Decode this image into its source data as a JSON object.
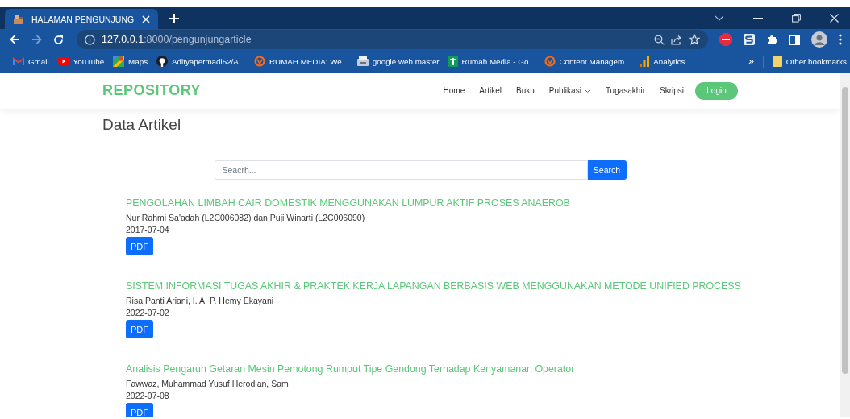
{
  "browser": {
    "tabs": [
      {
        "title": "HALAMAN PENGUNJUNG",
        "selected": true
      }
    ],
    "nav_buttons": [
      {
        "kind": "back",
        "disabled": false
      },
      {
        "kind": "forward",
        "disabled": true
      },
      {
        "kind": "reload",
        "disabled": false
      }
    ],
    "url_host": "127.0.0.1",
    "url_path": ":8000/pengunjungarticle",
    "bookmarks": [
      {
        "kind": "gmail",
        "label": "Gmail"
      },
      {
        "kind": "youtube",
        "label": "YouTube"
      },
      {
        "kind": "maps",
        "label": "Maps"
      },
      {
        "kind": "github",
        "label": "Adityapermadi52/A..."
      },
      {
        "kind": "ring",
        "label": "RUMAH MEDIA: We..."
      },
      {
        "kind": "tray",
        "label": "google web master"
      },
      {
        "kind": "sheet",
        "label": "Rumah Media - Go..."
      },
      {
        "kind": "ring",
        "label": "Content Managem..."
      },
      {
        "kind": "bars",
        "label": "Analytics"
      }
    ],
    "overflow": "»",
    "other_bookmarks": "Other bookmarks"
  },
  "site": {
    "brand": "REPOSITORY",
    "nav": [
      {
        "label": "Home",
        "dropdown": false
      },
      {
        "label": "Artikel",
        "dropdown": false
      },
      {
        "label": "Buku",
        "dropdown": false
      },
      {
        "label": "Publikasi",
        "dropdown": true
      },
      {
        "label": "Tugasakhir",
        "dropdown": false
      },
      {
        "label": "Skripsi",
        "dropdown": false
      }
    ],
    "login": "Login"
  },
  "page_title": "Data Artikel",
  "search": {
    "placeholder": "Seacrh...",
    "button": "Search"
  },
  "articles": [
    {
      "title": "PENGOLAHAN LIMBAH CAIR DOMESTIK MENGGUNAKAN LUMPUR AKTIF PROSES ANAEROB",
      "authors": "Nur Rahmi Sa'adah (L2C006082) dan Puji Winarti (L2C006090)",
      "date": "2017-07-04",
      "button": "PDF"
    },
    {
      "title": "SISTEM INFORMASI TUGAS AKHIR & PRAKTEK KERJA LAPANGAN BERBASIS WEB MENGGUNAKAN METODE UNIFIED PROCESS",
      "authors": "Risa Panti Ariani, I. A. P. Hemy Ekayani",
      "date": "2022-07-02",
      "button": "PDF"
    },
    {
      "title": "Analisis Pengaruh Getaran Mesin Pemotong Rumput Tipe Gendong Terhadap Kenyamanan Operator",
      "authors": "Fawwaz, Muhammad Yusuf Herodian, Sam",
      "date": "2022-07-08",
      "button": "PDF"
    }
  ]
}
